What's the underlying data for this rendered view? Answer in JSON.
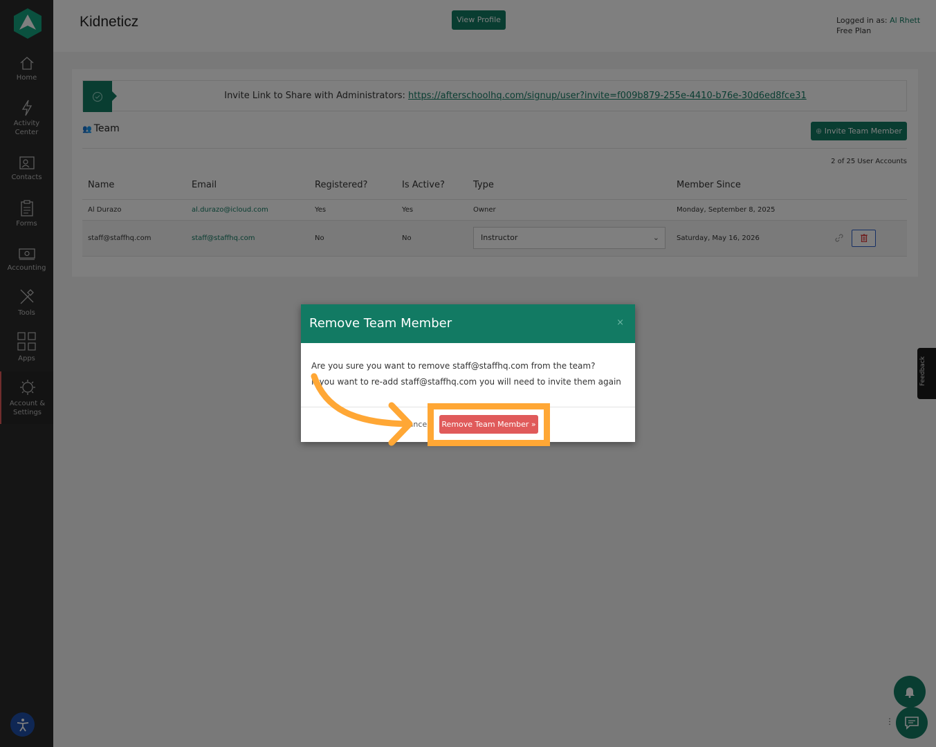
{
  "sidebar": {
    "items": [
      {
        "label": "Home",
        "icon": "home-icon"
      },
      {
        "label": "Activity Center",
        "icon": "lightning-icon"
      },
      {
        "label": "Contacts",
        "icon": "contacts-icon"
      },
      {
        "label": "Forms",
        "icon": "clipboard-icon"
      },
      {
        "label": "Accounting",
        "icon": "money-icon"
      },
      {
        "label": "Tools",
        "icon": "tools-icon"
      },
      {
        "label": "Apps",
        "icon": "grid-icon"
      },
      {
        "label": "Account & Settings",
        "icon": "gear-icon"
      }
    ],
    "active": "Account & Settings"
  },
  "header": {
    "org_name": "Kidneticz",
    "view_profile": "View Profile",
    "logged_in_prefix": "Logged in as: ",
    "logged_in_user": "Al Rhett",
    "plan": "Free Plan"
  },
  "invite": {
    "label": "Invite Link to Share with Administrators: ",
    "url": "https://afterschoolhq.com/signup/user?invite=f009b879-255e-4410-b76e-30d6ed8fce31"
  },
  "team": {
    "title": "Team",
    "invite_button": "Invite Team Member",
    "accounts_count": "2 of 25 User Accounts",
    "columns": [
      "Name",
      "Email",
      "Registered?",
      "Is Active?",
      "Type",
      "Member Since"
    ],
    "rows": [
      {
        "name": "Al Durazo",
        "email": "al.durazo@icloud.com",
        "registered": "Yes",
        "active": "Yes",
        "type": "Owner",
        "since": "Monday, September 8, 2025"
      },
      {
        "name": "staff@staffhq.com",
        "email": "staff@staffhq.com",
        "registered": "No",
        "active": "No",
        "type": "Instructor",
        "since": "Saturday, May 16, 2026"
      }
    ]
  },
  "modal": {
    "title": "Remove Team Member",
    "close": "×",
    "line1": "Are you sure you want to remove staff@staffhq.com from the team?",
    "line2": "If you want to re-add staff@staffhq.com you will need to invite them again",
    "cancel": "Cancel",
    "confirm": "Remove Team Member »"
  },
  "feedback_tab": "Feedback",
  "colors": {
    "brand": "#127a63",
    "danger": "#e05a5a",
    "highlight": "#ffa735"
  }
}
